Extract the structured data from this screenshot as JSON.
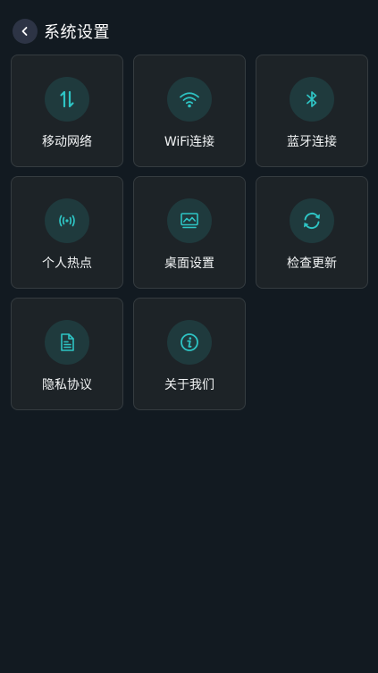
{
  "header": {
    "title": "系统设置",
    "back_icon": "chevron-left-icon"
  },
  "colors": {
    "background": "#121a21",
    "tile": "#1d2327",
    "tile_border": "#353c40",
    "icon_circle": "#1f3a3d",
    "accent": "#2ec4c4"
  },
  "tiles": [
    {
      "label": "移动网络",
      "icon": "mobile-data-icon"
    },
    {
      "label": "WiFi连接",
      "icon": "wifi-icon"
    },
    {
      "label": "蓝牙连接",
      "icon": "bluetooth-icon"
    },
    {
      "label": "个人热点",
      "icon": "hotspot-icon"
    },
    {
      "label": "桌面设置",
      "icon": "desktop-icon"
    },
    {
      "label": "检查更新",
      "icon": "refresh-icon"
    },
    {
      "label": "隐私协议",
      "icon": "document-icon"
    },
    {
      "label": "关于我们",
      "icon": "info-icon"
    }
  ]
}
